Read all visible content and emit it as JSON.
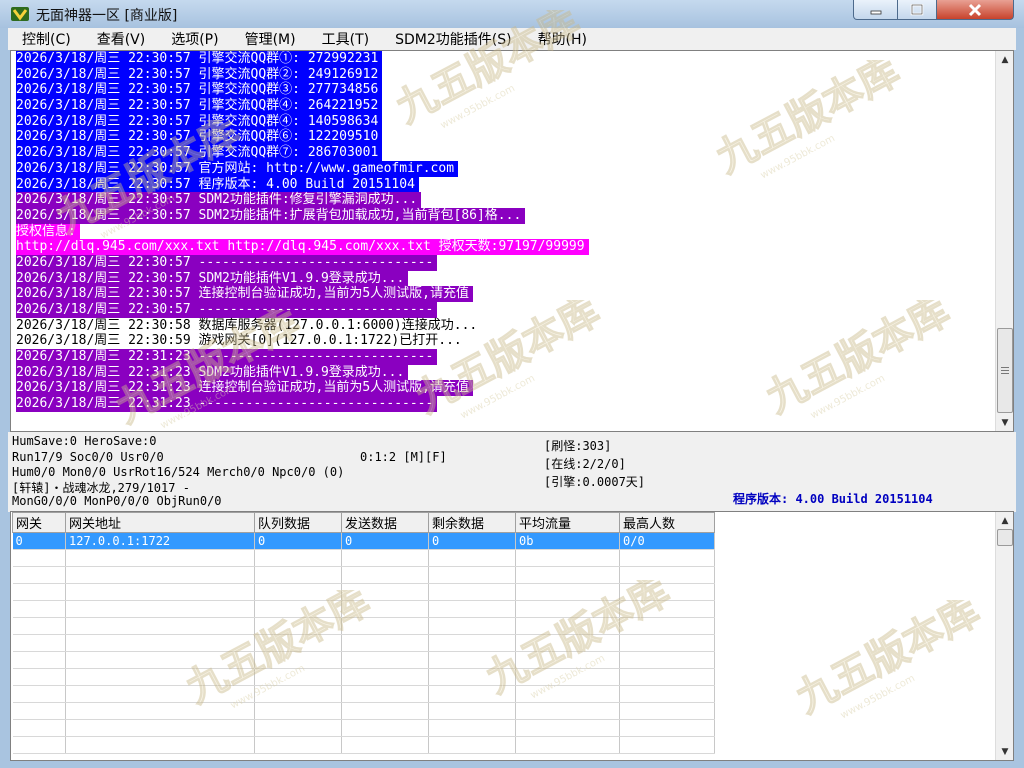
{
  "window": {
    "title": "无面神器一区 [商业版]"
  },
  "menu": [
    {
      "label": "控制(C)"
    },
    {
      "label": "查看(V)"
    },
    {
      "label": "选项(P)"
    },
    {
      "label": "管理(M)"
    },
    {
      "label": "工具(T)"
    },
    {
      "label": "SDM2功能插件(S)"
    },
    {
      "label": "帮助(H)"
    }
  ],
  "log": [
    {
      "style": "blue",
      "text": "2026/3/18/周三 22:30:57 引擎交流QQ群①: 272992231"
    },
    {
      "style": "blue",
      "text": "2026/3/18/周三 22:30:57 引擎交流QQ群②: 249126912"
    },
    {
      "style": "blue",
      "text": "2026/3/18/周三 22:30:57 引擎交流QQ群③: 277734856"
    },
    {
      "style": "blue",
      "text": "2026/3/18/周三 22:30:57 引擎交流QQ群④: 264221952"
    },
    {
      "style": "blue",
      "text": "2026/3/18/周三 22:30:57 引擎交流QQ群④: 140598634"
    },
    {
      "style": "blue",
      "text": "2026/3/18/周三 22:30:57 引擎交流QQ群⑥: 122209510"
    },
    {
      "style": "blue",
      "text": "2026/3/18/周三 22:30:57 引擎交流QQ群⑦: 286703001"
    },
    {
      "style": "blue",
      "text": "2026/3/18/周三 22:30:57 官方网站: http://www.gameofmir.com"
    },
    {
      "style": "blue",
      "text": "2026/3/18/周三 22:30:57 程序版本: 4.00 Build 20151104"
    },
    {
      "style": "purple",
      "text": "2026/3/18/周三 22:30:57 SDM2功能插件:修复引擎漏洞成功..."
    },
    {
      "style": "purple",
      "text": "2026/3/18/周三 22:30:57 SDM2功能插件:扩展背包加载成功,当前背包[86]格..."
    },
    {
      "style": "magenta",
      "text": "授权信息:"
    },
    {
      "style": "magenta",
      "text": "http://dlq.945.com/xxx.txt http://dlq.945.com/xxx.txt 授权天数:97197/99999"
    },
    {
      "style": "purple",
      "text": "2026/3/18/周三 22:30:57 ------------------------------"
    },
    {
      "style": "purple",
      "text": "2026/3/18/周三 22:30:57 SDM2功能插件V1.9.9登录成功..."
    },
    {
      "style": "purple",
      "text": "2026/3/18/周三 22:30:57 连接控制台验证成功,当前为5人测试版,请充值"
    },
    {
      "style": "purple",
      "text": "2026/3/18/周三 22:30:57 ------------------------------"
    },
    {
      "style": "none",
      "text": "2026/3/18/周三 22:30:58 数据库服务器(127.0.0.1:6000)连接成功..."
    },
    {
      "style": "none",
      "text": "2026/3/18/周三 22:30:59 游戏网关[0](127.0.0.1:1722)已打开..."
    },
    {
      "style": "purple",
      "text": "2026/3/18/周三 22:31:23 ------------------------------"
    },
    {
      "style": "purple",
      "text": "2026/3/18/周三 22:31:23 SDM2功能插件V1.9.9登录成功..."
    },
    {
      "style": "purple",
      "text": "2026/3/18/周三 22:31:23 连接控制台验证成功,当前为5人测试版,请充值"
    },
    {
      "style": "purple",
      "text": "2026/3/18/周三 22:31:23 ------------------------------"
    }
  ],
  "status": {
    "line1": "HumSave:0 HeroSave:0",
    "line2": "Run17/9 Soc0/0 Usr0/0",
    "line2b": "0:1:2 [M][F]",
    "line3": "Hum0/0 Mon0/0 UsrRot16/524 Merch0/0 Npc0/0 (0)",
    "line4": "[轩辕]・战魂冰龙,279/1017 -",
    "line5": "MonG0/0/0 MonP0/0/0 ObjRun0/0",
    "refresh": "[刷怪:303]",
    "online": "[在线:2/2/0]",
    "engine": "[引擎:0.0007天]",
    "version": "程序版本: 4.00 Build 20151104"
  },
  "gate_table": {
    "columns": [
      "网关",
      "网关地址",
      "队列数据",
      "发送数据",
      "剩余数据",
      "平均流量",
      "最高人数"
    ],
    "rows": [
      [
        "0",
        "127.0.0.1:1722",
        "0",
        "0",
        "0",
        "0b",
        "0/0"
      ]
    ]
  },
  "watermark_text": "九五版本库",
  "watermark_url": "www.95bbk.com",
  "colors": {
    "log_blue": "#0000ff",
    "log_purple": "#8a00c0",
    "log_magenta": "#ff00ff",
    "selected_row": "#3399ff",
    "version_text": "#0000c0"
  }
}
